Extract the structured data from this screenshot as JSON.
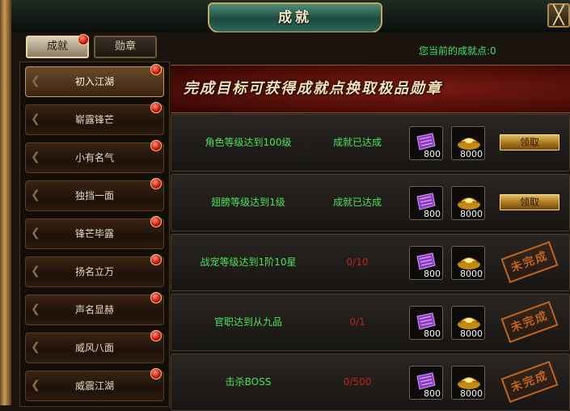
{
  "window": {
    "title": "成就",
    "close_label": "╳"
  },
  "tabs": [
    {
      "label": "成就",
      "active": true
    },
    {
      "label": "勋章",
      "active": false
    }
  ],
  "points_text": "您当前的成就点:0",
  "banner_text": "完成目标可获得成就点换取极品勋章",
  "sidebar": [
    {
      "label": "初入江湖",
      "selected": true
    },
    {
      "label": "崭露锋芒"
    },
    {
      "label": "小有名气"
    },
    {
      "label": "独挡一面"
    },
    {
      "label": "锋芒毕露"
    },
    {
      "label": "扬名立万"
    },
    {
      "label": "声名显赫"
    },
    {
      "label": "威风八面"
    },
    {
      "label": "威震江湖"
    }
  ],
  "achievements": [
    {
      "name": "角色等级达到100级",
      "status": "成就已达成",
      "done": true,
      "reward1": "800",
      "reward2": "8000",
      "action": "领取"
    },
    {
      "name": "翅膀等级达到1级",
      "status": "成就已达成",
      "done": true,
      "reward1": "800",
      "reward2": "8000",
      "action": "领取"
    },
    {
      "name": "战宠等级达到1阶10星",
      "status": "0/10",
      "done": false,
      "reward1": "800",
      "reward2": "8000",
      "action": "未完成"
    },
    {
      "name": "官职达到从九品",
      "status": "0/1",
      "done": false,
      "reward1": "800",
      "reward2": "8000",
      "action": "未完成"
    },
    {
      "name": "击杀BOSS",
      "status": "0/500",
      "done": false,
      "reward1": "800",
      "reward2": "8000",
      "action": "未完成"
    }
  ],
  "colors": {
    "green_text": "#4ee25a",
    "red_text": "#c2201a",
    "gold": "#c9a55a"
  }
}
